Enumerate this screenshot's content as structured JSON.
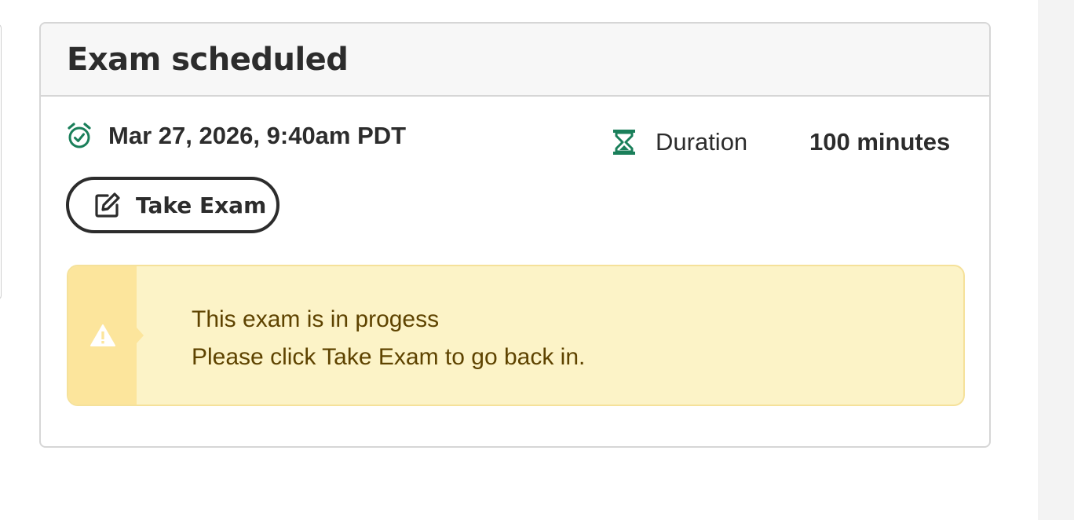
{
  "card": {
    "title": "Exam scheduled",
    "schedule": {
      "icon": "alarm-clock-check-icon",
      "datetime": "Mar 27, 2026, 9:40am PDT"
    },
    "duration": {
      "icon": "hourglass-icon",
      "label": "Duration",
      "value": "100 minutes"
    },
    "take_exam_button": {
      "icon": "edit-icon",
      "label": "Take Exam"
    },
    "alert": {
      "icon": "warning-icon",
      "line1": "This exam is in progess",
      "line2": "Please click Take Exam to go back in."
    }
  },
  "colors": {
    "icon_green": "#1a7f5a",
    "alert_bg": "#fcf3c7",
    "alert_stripe": "#fce59c",
    "alert_text": "#5e4300",
    "header_bg": "#f7f7f7"
  }
}
